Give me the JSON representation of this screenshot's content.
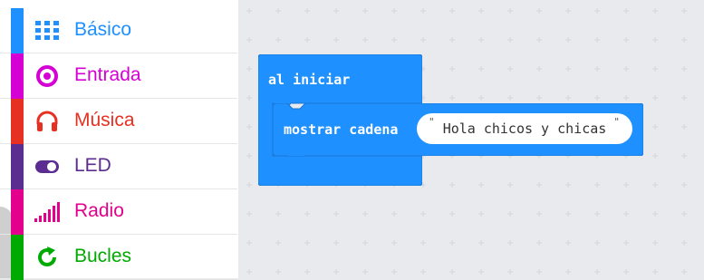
{
  "toolbox": {
    "categories": [
      {
        "label": "Básico",
        "color": "#1e90ff",
        "icon": "grid-icon"
      },
      {
        "label": "Entrada",
        "color": "#d400d4",
        "icon": "circle-target-icon"
      },
      {
        "label": "Música",
        "color": "#e63022",
        "icon": "headphones-icon"
      },
      {
        "label": "LED",
        "color": "#5c2d91",
        "icon": "toggle-icon"
      },
      {
        "label": "Radio",
        "color": "#e3008c",
        "icon": "signal-bars-icon"
      },
      {
        "label": "Bucles",
        "color": "#00aa00",
        "icon": "loop-arrow-icon"
      }
    ]
  },
  "workspace": {
    "on_start_block": {
      "label": "al iniciar",
      "color": "#1e90ff"
    },
    "show_string_block": {
      "label": "mostrar cadena",
      "value": "Hola chicos y chicas",
      "quote_open": "\"",
      "quote_close": "\""
    }
  }
}
